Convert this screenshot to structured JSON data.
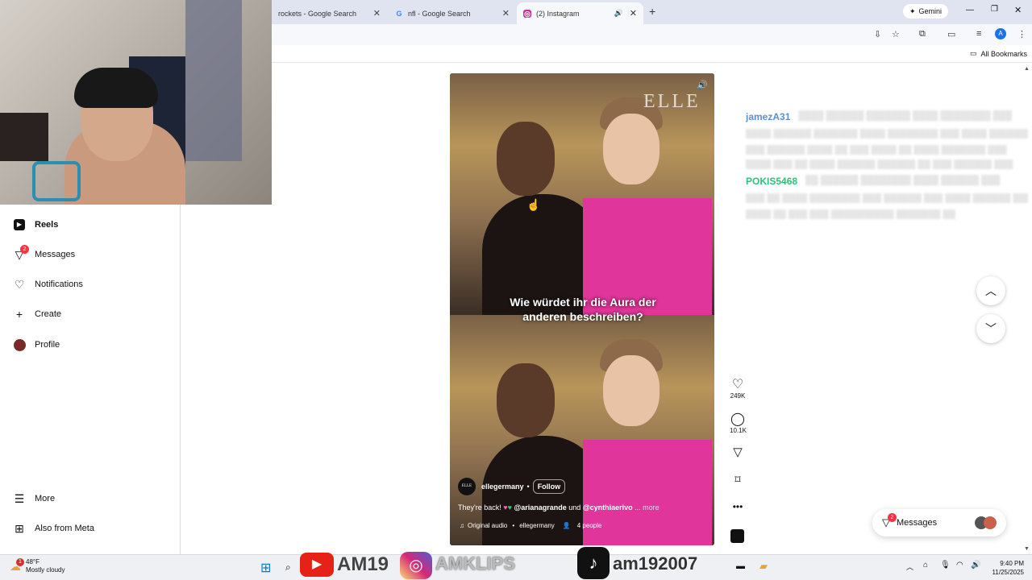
{
  "browser": {
    "tabs": [
      {
        "title": "rockets - Google Search"
      },
      {
        "title": "nfl - Google Search"
      },
      {
        "title": "(2) Instagram"
      }
    ],
    "gemini_label": "Gemini",
    "bookmarks_label": "All Bookmarks",
    "profile_initial": "A"
  },
  "sidebar": {
    "items": [
      {
        "label": "Reels",
        "icon": "reels-icon"
      },
      {
        "label": "Messages",
        "icon": "messages-icon",
        "badge": "2"
      },
      {
        "label": "Notifications",
        "icon": "heart-icon"
      },
      {
        "label": "Create",
        "icon": "plus-icon"
      },
      {
        "label": "Profile",
        "icon": "avatar"
      }
    ],
    "bottom": [
      {
        "label": "More",
        "icon": "menu-icon"
      },
      {
        "label": "Also from Meta",
        "icon": "meta-icon"
      }
    ]
  },
  "reel": {
    "watermark": "ELLE",
    "subtitle_line1": "Wie würdet ihr die Aura der",
    "subtitle_line2": "anderen beschreiben?",
    "account": "ellegermany",
    "follow_label": "Follow",
    "caption_prefix": "They're back!",
    "caption_mention1": "@arianagrande",
    "caption_und": "und",
    "caption_mention2": "@cynthiaerivo",
    "caption_more": "... more",
    "audio": "Original audio",
    "audio_account": "ellegermany",
    "people": "4 people",
    "account_logo_text": "ELLE"
  },
  "actions": {
    "likes": "249K",
    "comments": "10.1K"
  },
  "chat": [
    {
      "user": "jamezA31",
      "color": "#5b8fd6"
    },
    {
      "user": "POKIS5468",
      "color": "#2fbf7a"
    }
  ],
  "messages_pill": {
    "label": "Messages",
    "badge": "2"
  },
  "taskbar": {
    "weather_temp": "48°F",
    "weather_desc": "Mostly cloudy",
    "weather_badge": "1",
    "time": "9:40 PM",
    "date": "11/25/2025",
    "overlay_text1": "AM19",
    "overlay_text2": "AMKLIPS",
    "overlay_text3": "am192007"
  }
}
